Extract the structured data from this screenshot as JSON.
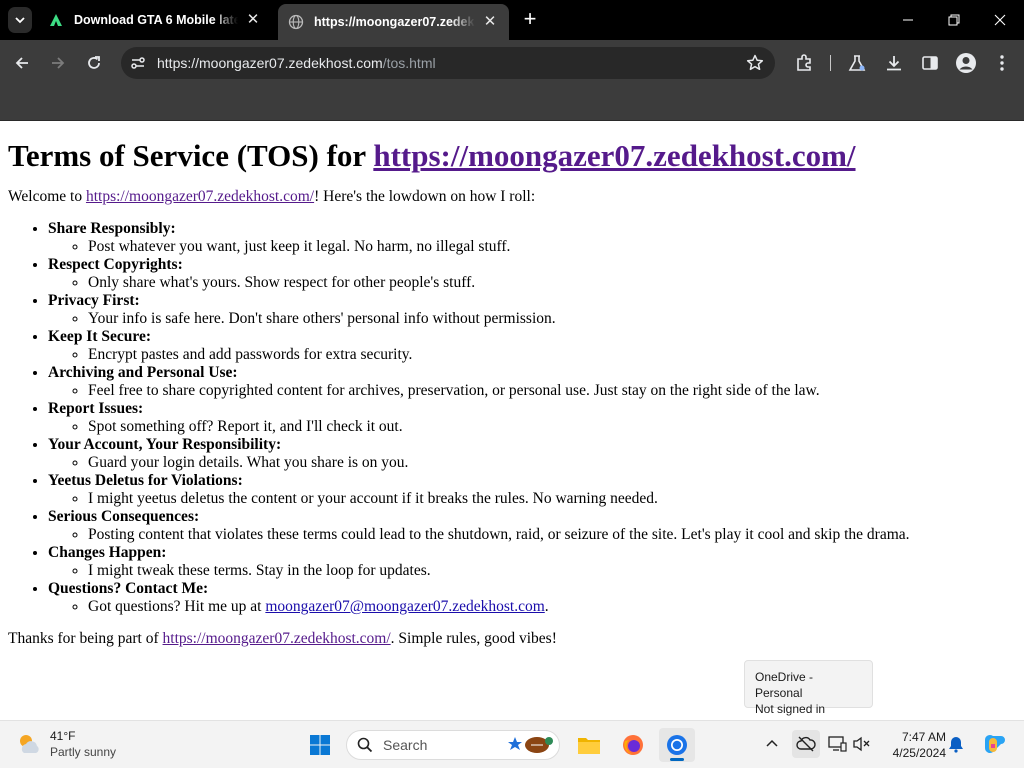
{
  "tabs": [
    {
      "title": "Download GTA 6 Mobile latest",
      "active": false
    },
    {
      "title": "https://moongazer07.zedekhost.com/tos.html",
      "active": true
    }
  ],
  "address_bar": {
    "host": "https://moongazer07.zedekhost.com",
    "path": "/tos.html"
  },
  "page": {
    "heading_prefix": "Terms of Service (TOS) for ",
    "heading_link": "https://moongazer07.zedekhost.com/",
    "intro_prefix": "Welcome to ",
    "intro_link": "https://moongazer07.zedekhost.com/",
    "intro_suffix": "! Here's the lowdown on how I roll:",
    "rules": [
      {
        "title": "Share Responsibly:",
        "text": "Post whatever you want, just keep it legal. No harm, no illegal stuff."
      },
      {
        "title": "Respect Copyrights:",
        "text": "Only share what's yours. Show respect for other people's stuff."
      },
      {
        "title": "Privacy First:",
        "text": "Your info is safe here. Don't share others' personal info without permission."
      },
      {
        "title": "Keep It Secure:",
        "text": "Encrypt pastes and add passwords for extra security."
      },
      {
        "title": "Archiving and Personal Use:",
        "text": "Feel free to share copyrighted content for archives, preservation, or personal use. Just stay on the right side of the law."
      },
      {
        "title": "Report Issues:",
        "text": "Spot something off? Report it, and I'll check it out."
      },
      {
        "title": "Your Account, Your Responsibility:",
        "text": "Guard your login details. What you share is on you."
      },
      {
        "title": "Yeetus Deletus for Violations:",
        "text": "I might yeetus deletus the content or your account if it breaks the rules. No warning needed."
      },
      {
        "title": "Serious Consequences:",
        "text": "Posting content that violates these terms could lead to the shutdown, raid, or seizure of the site. Let's play it cool and skip the drama."
      },
      {
        "title": "Changes Happen:",
        "text": "I might tweak these terms. Stay in the loop for updates."
      }
    ],
    "contact": {
      "title": "Questions? Contact Me:",
      "text_prefix": "Got questions? Hit me up at ",
      "email": "moongazer07@moongazer07.zedekhost.com",
      "text_suffix": "."
    },
    "outro_prefix": "Thanks for being part of ",
    "outro_link": "https://moongazer07.zedekhost.com/",
    "outro_suffix": ". Simple rules, good vibes!"
  },
  "tooltip": {
    "line1": "OneDrive - Personal",
    "line2": "Not signed in"
  },
  "taskbar": {
    "weather": {
      "temp": "41°F",
      "condition": "Partly sunny"
    },
    "search_placeholder": "Search",
    "time": "7:47 AM",
    "date": "4/25/2024"
  },
  "colors": {
    "link_visited": "#551a8b",
    "link": "#1a0dab",
    "accent": "#0067c0"
  }
}
